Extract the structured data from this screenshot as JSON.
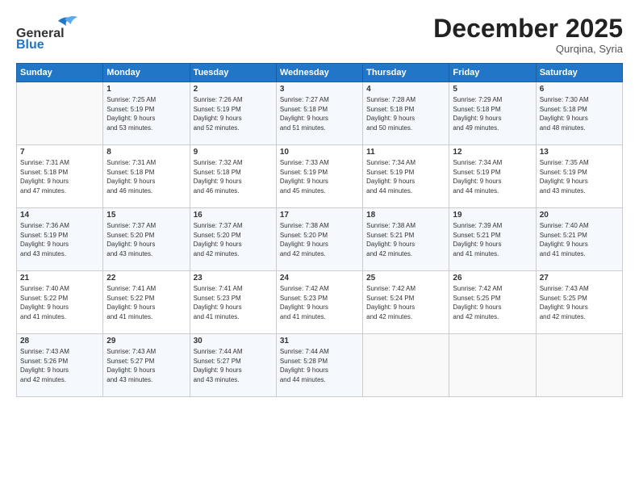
{
  "header": {
    "logo_general": "General",
    "logo_blue": "Blue",
    "month_title": "December 2025",
    "subtitle": "Qurqina, Syria"
  },
  "days_of_week": [
    "Sunday",
    "Monday",
    "Tuesday",
    "Wednesday",
    "Thursday",
    "Friday",
    "Saturday"
  ],
  "weeks": [
    [
      {
        "num": "",
        "info": ""
      },
      {
        "num": "1",
        "info": "Sunrise: 7:25 AM\nSunset: 5:19 PM\nDaylight: 9 hours\nand 53 minutes."
      },
      {
        "num": "2",
        "info": "Sunrise: 7:26 AM\nSunset: 5:19 PM\nDaylight: 9 hours\nand 52 minutes."
      },
      {
        "num": "3",
        "info": "Sunrise: 7:27 AM\nSunset: 5:18 PM\nDaylight: 9 hours\nand 51 minutes."
      },
      {
        "num": "4",
        "info": "Sunrise: 7:28 AM\nSunset: 5:18 PM\nDaylight: 9 hours\nand 50 minutes."
      },
      {
        "num": "5",
        "info": "Sunrise: 7:29 AM\nSunset: 5:18 PM\nDaylight: 9 hours\nand 49 minutes."
      },
      {
        "num": "6",
        "info": "Sunrise: 7:30 AM\nSunset: 5:18 PM\nDaylight: 9 hours\nand 48 minutes."
      }
    ],
    [
      {
        "num": "7",
        "info": "Sunrise: 7:31 AM\nSunset: 5:18 PM\nDaylight: 9 hours\nand 47 minutes."
      },
      {
        "num": "8",
        "info": "Sunrise: 7:31 AM\nSunset: 5:18 PM\nDaylight: 9 hours\nand 46 minutes."
      },
      {
        "num": "9",
        "info": "Sunrise: 7:32 AM\nSunset: 5:18 PM\nDaylight: 9 hours\nand 46 minutes."
      },
      {
        "num": "10",
        "info": "Sunrise: 7:33 AM\nSunset: 5:19 PM\nDaylight: 9 hours\nand 45 minutes."
      },
      {
        "num": "11",
        "info": "Sunrise: 7:34 AM\nSunset: 5:19 PM\nDaylight: 9 hours\nand 44 minutes."
      },
      {
        "num": "12",
        "info": "Sunrise: 7:34 AM\nSunset: 5:19 PM\nDaylight: 9 hours\nand 44 minutes."
      },
      {
        "num": "13",
        "info": "Sunrise: 7:35 AM\nSunset: 5:19 PM\nDaylight: 9 hours\nand 43 minutes."
      }
    ],
    [
      {
        "num": "14",
        "info": "Sunrise: 7:36 AM\nSunset: 5:19 PM\nDaylight: 9 hours\nand 43 minutes."
      },
      {
        "num": "15",
        "info": "Sunrise: 7:37 AM\nSunset: 5:20 PM\nDaylight: 9 hours\nand 43 minutes."
      },
      {
        "num": "16",
        "info": "Sunrise: 7:37 AM\nSunset: 5:20 PM\nDaylight: 9 hours\nand 42 minutes."
      },
      {
        "num": "17",
        "info": "Sunrise: 7:38 AM\nSunset: 5:20 PM\nDaylight: 9 hours\nand 42 minutes."
      },
      {
        "num": "18",
        "info": "Sunrise: 7:38 AM\nSunset: 5:21 PM\nDaylight: 9 hours\nand 42 minutes."
      },
      {
        "num": "19",
        "info": "Sunrise: 7:39 AM\nSunset: 5:21 PM\nDaylight: 9 hours\nand 41 minutes."
      },
      {
        "num": "20",
        "info": "Sunrise: 7:40 AM\nSunset: 5:21 PM\nDaylight: 9 hours\nand 41 minutes."
      }
    ],
    [
      {
        "num": "21",
        "info": "Sunrise: 7:40 AM\nSunset: 5:22 PM\nDaylight: 9 hours\nand 41 minutes."
      },
      {
        "num": "22",
        "info": "Sunrise: 7:41 AM\nSunset: 5:22 PM\nDaylight: 9 hours\nand 41 minutes."
      },
      {
        "num": "23",
        "info": "Sunrise: 7:41 AM\nSunset: 5:23 PM\nDaylight: 9 hours\nand 41 minutes."
      },
      {
        "num": "24",
        "info": "Sunrise: 7:42 AM\nSunset: 5:23 PM\nDaylight: 9 hours\nand 41 minutes."
      },
      {
        "num": "25",
        "info": "Sunrise: 7:42 AM\nSunset: 5:24 PM\nDaylight: 9 hours\nand 42 minutes."
      },
      {
        "num": "26",
        "info": "Sunrise: 7:42 AM\nSunset: 5:25 PM\nDaylight: 9 hours\nand 42 minutes."
      },
      {
        "num": "27",
        "info": "Sunrise: 7:43 AM\nSunset: 5:25 PM\nDaylight: 9 hours\nand 42 minutes."
      }
    ],
    [
      {
        "num": "28",
        "info": "Sunrise: 7:43 AM\nSunset: 5:26 PM\nDaylight: 9 hours\nand 42 minutes."
      },
      {
        "num": "29",
        "info": "Sunrise: 7:43 AM\nSunset: 5:27 PM\nDaylight: 9 hours\nand 43 minutes."
      },
      {
        "num": "30",
        "info": "Sunrise: 7:44 AM\nSunset: 5:27 PM\nDaylight: 9 hours\nand 43 minutes."
      },
      {
        "num": "31",
        "info": "Sunrise: 7:44 AM\nSunset: 5:28 PM\nDaylight: 9 hours\nand 44 minutes."
      },
      {
        "num": "",
        "info": ""
      },
      {
        "num": "",
        "info": ""
      },
      {
        "num": "",
        "info": ""
      }
    ]
  ]
}
